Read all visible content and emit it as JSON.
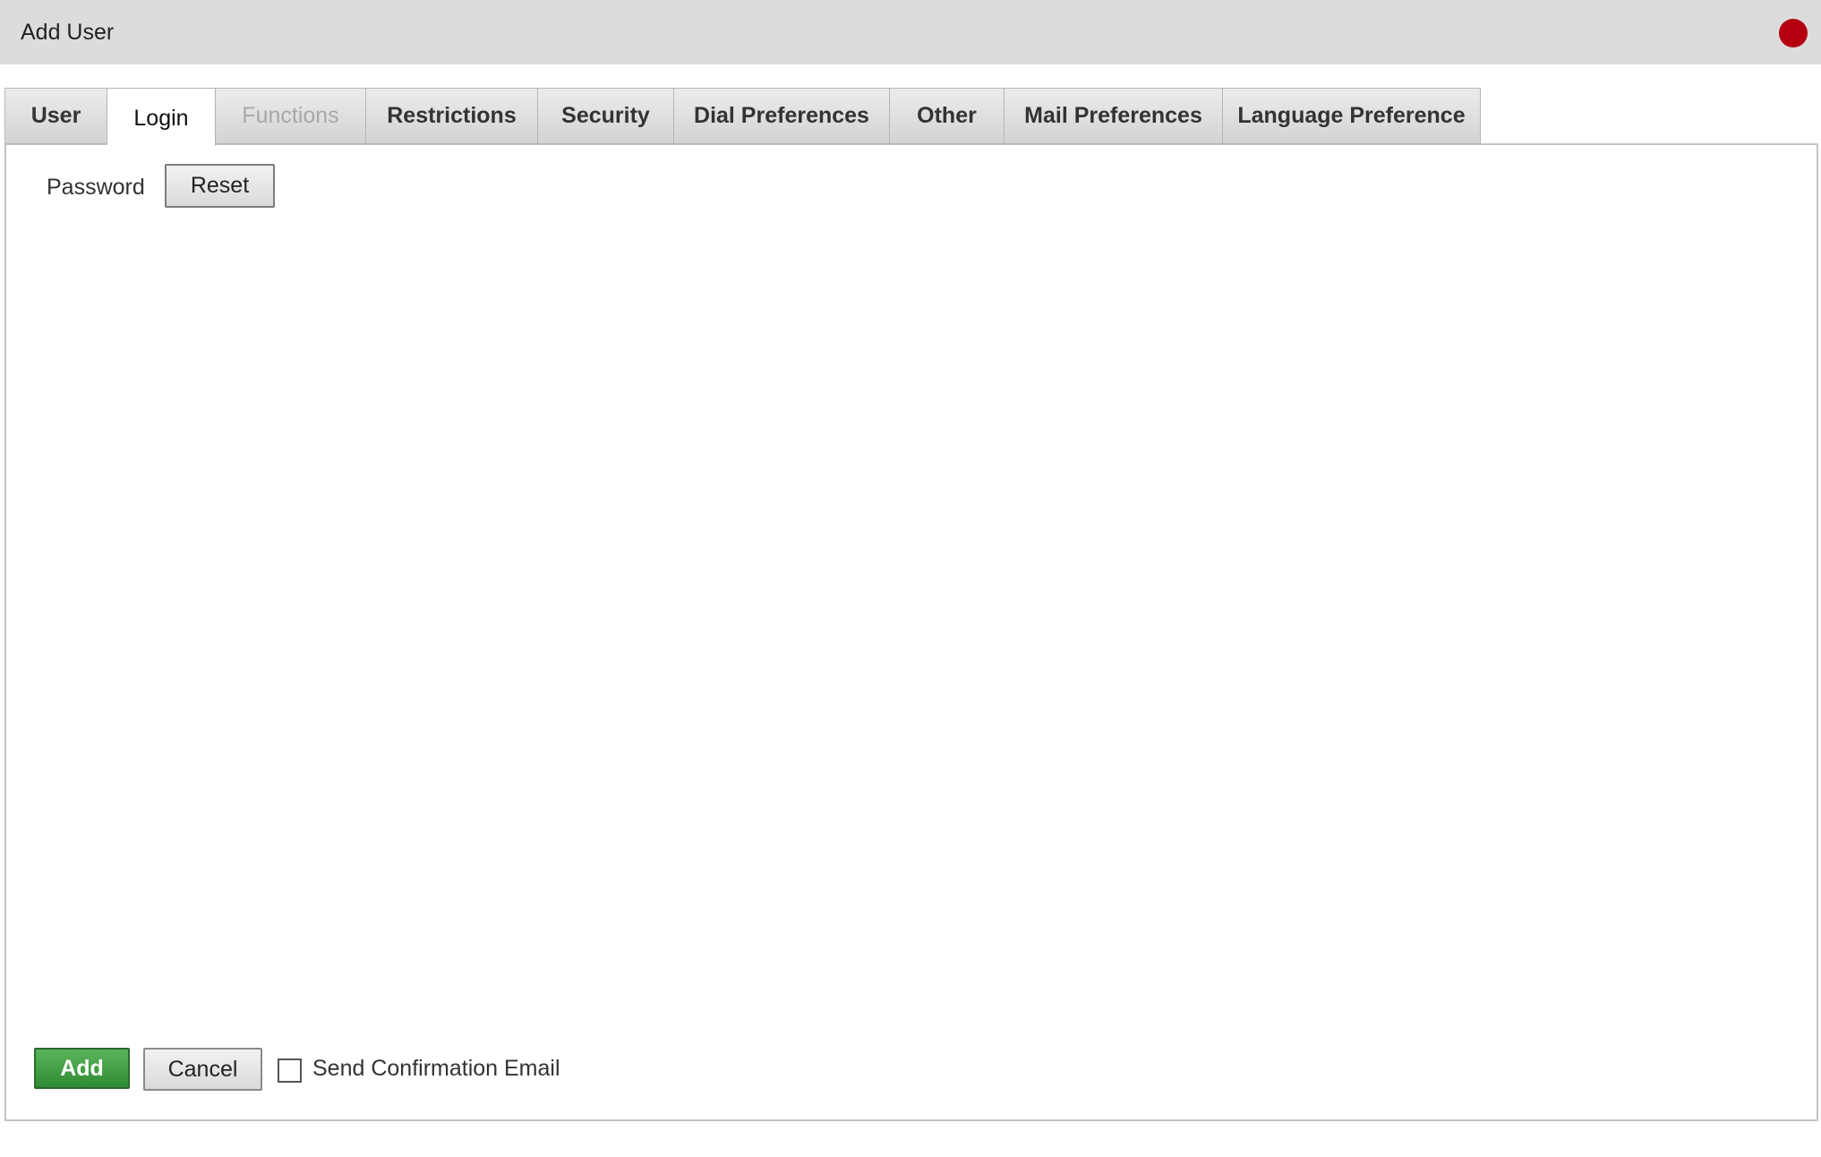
{
  "window": {
    "title": "Add User",
    "close_color": "#b50010"
  },
  "tabs": [
    {
      "label": "User",
      "state": "normal"
    },
    {
      "label": "Login",
      "state": "active"
    },
    {
      "label": "Functions",
      "state": "disabled"
    },
    {
      "label": "Restrictions",
      "state": "normal"
    },
    {
      "label": "Security",
      "state": "normal"
    },
    {
      "label": "Dial Preferences",
      "state": "normal"
    },
    {
      "label": "Other",
      "state": "normal"
    },
    {
      "label": "Mail Preferences",
      "state": "normal"
    },
    {
      "label": "Language Preference",
      "state": "normal"
    }
  ],
  "login": {
    "password_label": "Password",
    "reset_label": "Reset"
  },
  "footer": {
    "add_label": "Add",
    "cancel_label": "Cancel",
    "confirm_email_label": "Send Confirmation Email",
    "confirm_email_checked": false,
    "add_color": "#3e9e41"
  }
}
